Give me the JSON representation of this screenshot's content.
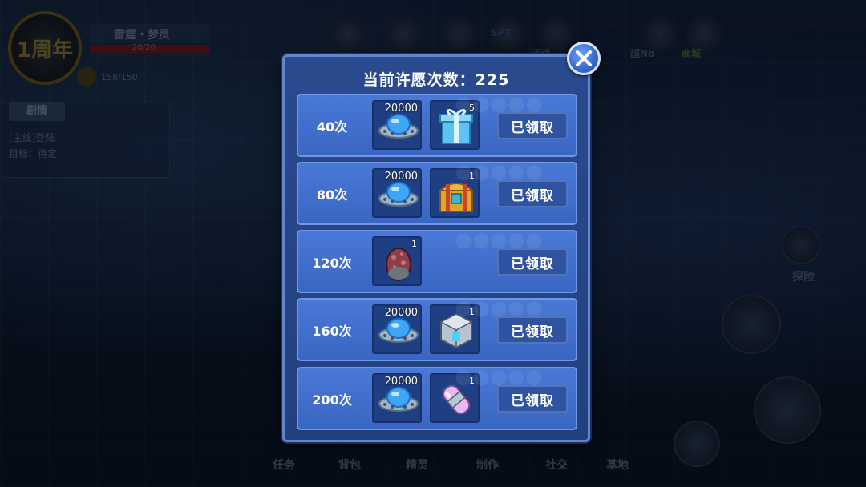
{
  "background": {
    "anniversary_badge": "1周年",
    "player_name": "雷霆・梦灵",
    "hp": {
      "text": "20/20",
      "fraction": 1.0
    },
    "energy": "158/150",
    "quest_panel": {
      "tab": "剧情",
      "line1": "[主线]登陆",
      "line2": "目标：待定"
    },
    "top_menu": [
      "SPT",
      "活动",
      "超No",
      "商城"
    ],
    "explore_label": "探险",
    "bottom_menu": [
      "任务",
      "背包",
      "精灵",
      "制作",
      "社交",
      "基地"
    ]
  },
  "dialog": {
    "title": "当前许愿次数：225",
    "close_icon": "close-icon",
    "rows": [
      {
        "count": "40次",
        "rewards": [
          {
            "icon": "ufo-currency-icon",
            "qty": "20000"
          },
          {
            "icon": "gift-box-icon",
            "qty": "5"
          }
        ],
        "button": "已领取"
      },
      {
        "count": "80次",
        "rewards": [
          {
            "icon": "ufo-currency-icon",
            "qty": "20000"
          },
          {
            "icon": "treasure-chest-icon",
            "qty": "1"
          }
        ],
        "button": "已领取"
      },
      {
        "count": "120次",
        "rewards": [
          {
            "icon": "spotted-egg-icon",
            "qty": "1"
          }
        ],
        "button": "已领取"
      },
      {
        "count": "160次",
        "rewards": [
          {
            "icon": "ufo-currency-icon",
            "qty": "20000"
          },
          {
            "icon": "crystal-cube-icon",
            "qty": "1"
          }
        ],
        "button": "已领取"
      },
      {
        "count": "200次",
        "rewards": [
          {
            "icon": "ufo-currency-icon",
            "qty": "20000"
          },
          {
            "icon": "energy-capsule-icon",
            "qty": "1"
          }
        ],
        "button": "已领取"
      }
    ]
  },
  "colors": {
    "dialog_bg": "#2b4a8f",
    "row_bg": "#4a78d6",
    "slot_bg": "#1f3f84",
    "button_bg": "#2f53a0",
    "close_button": "#3669c7"
  }
}
